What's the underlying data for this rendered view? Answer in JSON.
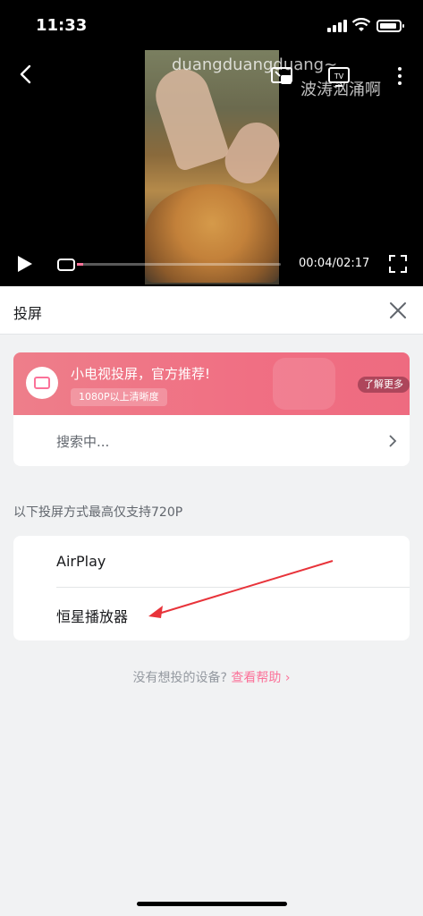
{
  "status_bar": {
    "time": "11:33"
  },
  "video": {
    "overlay_text_1": "duangduangduang~",
    "overlay_text_2": "波涛汹涌啊",
    "time_display": "00:04/02:17",
    "progress_fraction": 0.03
  },
  "sheet": {
    "title": "投屏",
    "promo": {
      "title": "小电视投屏，官方推荐!",
      "subtitle": "1080P以上清晰度",
      "more_label": "了解更多"
    },
    "search_label": "搜索中...",
    "note": "以下投屏方式最高仅支持720P",
    "devices": [
      {
        "label": "AirPlay"
      },
      {
        "label": "恒星播放器"
      }
    ],
    "help_question": "没有想投的设备?",
    "help_link": "查看帮助"
  },
  "colors": {
    "accent": "#fb7299",
    "promo_bg": "#f06f83",
    "page_bg": "#f1f2f3"
  }
}
